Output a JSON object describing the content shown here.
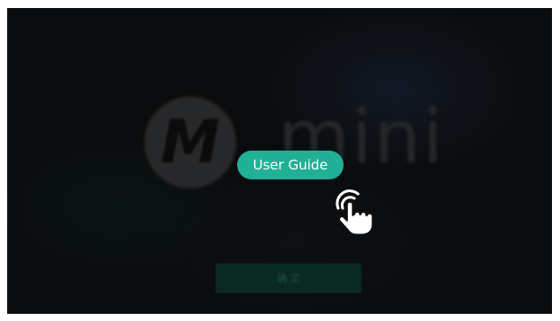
{
  "screen": {
    "logo": {
      "mark_letter": "M",
      "wordmark": "mini"
    },
    "bottom_button_label": "确 定",
    "guide": {
      "label": "User Guide",
      "icon": "tap-hand-icon",
      "accent_color": "#1fb095"
    }
  }
}
